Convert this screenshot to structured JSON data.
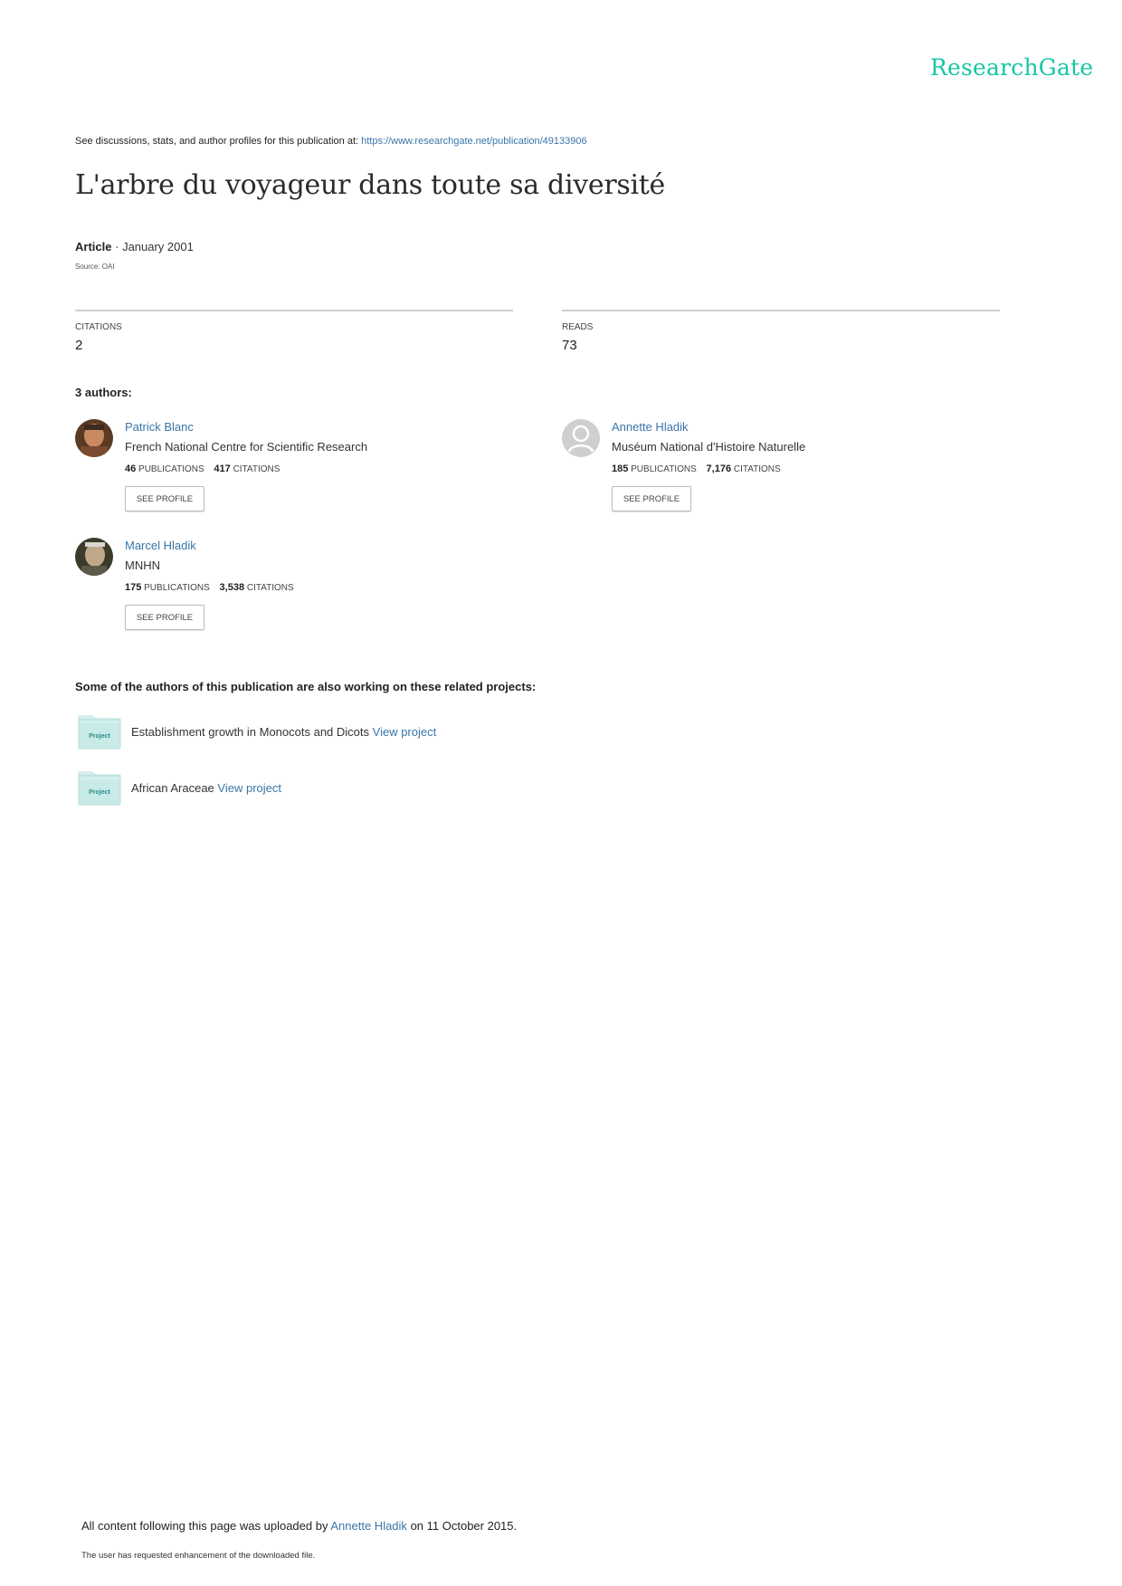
{
  "brand": {
    "logo": "ResearchGate"
  },
  "header": {
    "see_text": "See discussions, stats, and author profiles for this publication at:",
    "url": "https://www.researchgate.net/publication/49133906"
  },
  "publication": {
    "title": "L'arbre du voyageur dans toute sa diversité",
    "type": "Article",
    "separator": "·",
    "date": "January 2001",
    "source": "Source: OAI"
  },
  "stats": {
    "citations_label": "CITATIONS",
    "citations_value": "2",
    "reads_label": "READS",
    "reads_value": "73"
  },
  "authors_heading": "3 authors:",
  "authors": [
    {
      "name": "Patrick Blanc",
      "institution": "French National Centre for Scientific Research",
      "publications": "46",
      "publications_label": "PUBLICATIONS",
      "citations": "417",
      "citations_label": "CITATIONS",
      "button": "SEE PROFILE"
    },
    {
      "name": "Annette Hladik",
      "institution": "Muséum National d'Histoire Naturelle",
      "publications": "185",
      "publications_label": "PUBLICATIONS",
      "citations": "7,176",
      "citations_label": "CITATIONS",
      "button": "SEE PROFILE"
    },
    {
      "name": "Marcel Hladik",
      "institution": "MNHN",
      "publications": "175",
      "publications_label": "PUBLICATIONS",
      "citations": "3,538",
      "citations_label": "CITATIONS",
      "button": "SEE PROFILE"
    }
  ],
  "related_heading": "Some of the authors of this publication are also working on these related projects:",
  "projects": [
    {
      "badge": "Project",
      "name": "Establishment growth in Monocots and Dicots",
      "link": "View project"
    },
    {
      "badge": "Project",
      "name": "African Araceae",
      "link": "View project"
    }
  ],
  "footer": {
    "uploaded_prefix": "All content following this page was uploaded by",
    "uploader": "Annette Hladik",
    "uploaded_suffix": "on 11 October 2015.",
    "note": "The user has requested enhancement of the downloaded file."
  },
  "colors": {
    "brand": "#16c6a4",
    "link": "#3a75a8",
    "folder": "#c9ebe8",
    "folder_text": "#2a8d8a"
  }
}
